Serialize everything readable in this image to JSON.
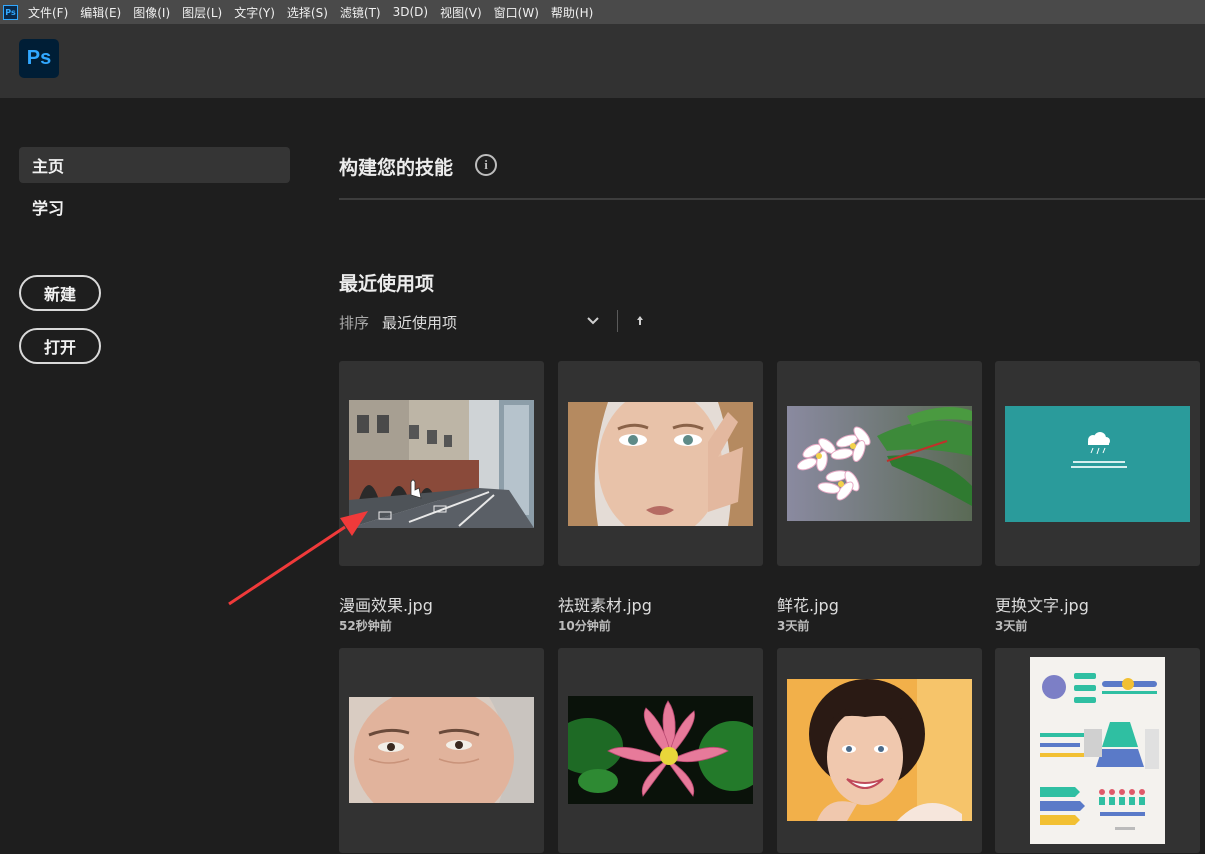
{
  "menubar": {
    "app_icon": "Ps",
    "items": [
      "文件(F)",
      "编辑(E)",
      "图像(I)",
      "图层(L)",
      "文字(Y)",
      "选择(S)",
      "滤镜(T)",
      "3D(D)",
      "视图(V)",
      "窗口(W)",
      "帮助(H)"
    ]
  },
  "header": {
    "logo": "Ps"
  },
  "sidebar": {
    "items": [
      {
        "label": "主页",
        "active": true
      },
      {
        "label": "学习",
        "active": false
      }
    ],
    "new_button": "新建",
    "open_button": "打开"
  },
  "main": {
    "skills_title": "构建您的技能",
    "info_glyph": "i",
    "recent_title": "最近使用项",
    "sort_label": "排序",
    "sort_value": "最近使用项",
    "files": [
      {
        "name": "漫画效果.jpg",
        "time": "52秒钟前",
        "thumb": "street-photo"
      },
      {
        "name": "祛斑素材.jpg",
        "time": "10分钟前",
        "thumb": "woman-portrait"
      },
      {
        "name": "鲜花.jpg",
        "time": "3天前",
        "thumb": "plumeria-flowers"
      },
      {
        "name": "更换文字.jpg",
        "time": "3天前",
        "thumb": "teal-slide"
      },
      {
        "thumb": "elderly-woman-face"
      },
      {
        "thumb": "lotus-flower"
      },
      {
        "thumb": "smiling-girl"
      },
      {
        "thumb": "infographic"
      }
    ]
  },
  "colors": {
    "menubar": "#4a4a4a",
    "header": "#323232",
    "background": "#1e1e1e",
    "card": "#323232",
    "ps_blue": "#31a8ff",
    "annotation_arrow": "#f03a3a"
  }
}
